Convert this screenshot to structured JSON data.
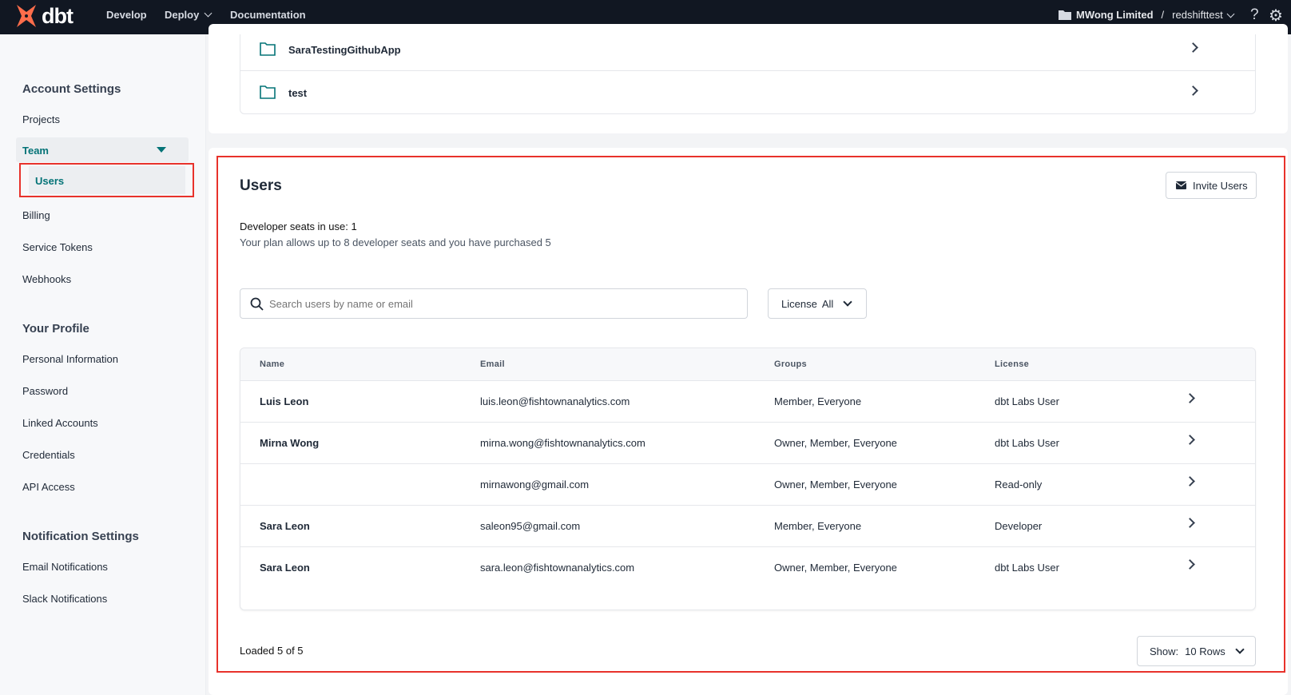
{
  "topbar": {
    "brand": "dbt",
    "nav": [
      "Develop",
      "Deploy",
      "Documentation"
    ],
    "account": "MWong Limited",
    "separator": "/",
    "project": "redshifttest",
    "help": "?"
  },
  "sidebar": {
    "sections": [
      {
        "title": "Account Settings",
        "items": [
          "Projects",
          "Team",
          "Users",
          "Billing",
          "Service Tokens",
          "Webhooks"
        ]
      },
      {
        "title": "Your Profile",
        "items": [
          "Personal Information",
          "Password",
          "Linked Accounts",
          "Credentials",
          "API Access"
        ]
      },
      {
        "title": "Notification Settings",
        "items": [
          "Email Notifications",
          "Slack Notifications"
        ]
      }
    ],
    "active": "Users",
    "accent": "#047377"
  },
  "projects": [
    "SaraTestingGithubApp",
    "test"
  ],
  "users": {
    "title": "Users",
    "invite_label": "Invite Users",
    "seats": "Developer seats in use: 1",
    "plan": "Your plan allows up to 8 developer seats and you have purchased 5",
    "search_placeholder": "Search users by name or email",
    "license_filter": {
      "label": "License",
      "value": "All"
    },
    "columns": [
      "Name",
      "Email",
      "Groups",
      "License"
    ],
    "rows": [
      {
        "name": "Luis Leon",
        "email": "luis.leon@fishtownanalytics.com",
        "groups": "Member, Everyone",
        "license": "dbt Labs User"
      },
      {
        "name": "Mirna Wong",
        "email": "mirna.wong@fishtownanalytics.com",
        "groups": "Owner, Member, Everyone",
        "license": "dbt Labs User"
      },
      {
        "name": "",
        "email": "mirnawong@gmail.com",
        "groups": "Owner, Member, Everyone",
        "license": "Read-only"
      },
      {
        "name": "Sara Leon",
        "email": "saleon95@gmail.com",
        "groups": "Member, Everyone",
        "license": "Developer"
      },
      {
        "name": "Sara Leon",
        "email": "sara.leon@fishtownanalytics.com",
        "groups": "Owner, Member, Everyone",
        "license": "dbt Labs User"
      }
    ],
    "loaded": "Loaded 5 of 5",
    "show": {
      "label": "Show:",
      "value": "10 Rows"
    }
  },
  "highlight_color": "#e8322b"
}
